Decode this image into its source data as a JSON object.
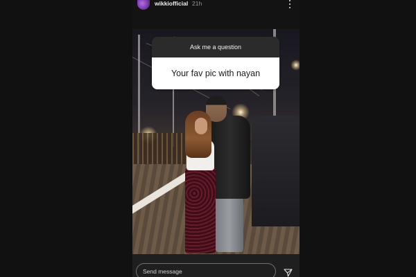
{
  "story": {
    "username": "wikkiofficial",
    "time_ago": "21h",
    "question_sticker": {
      "prompt": "Ask me a question",
      "answer": "Your fav pic with nayan"
    },
    "reply": {
      "placeholder": "Send message"
    }
  },
  "icons": {
    "more": "more-vertical-icon",
    "send": "paper-plane-icon"
  },
  "colors": {
    "background": "#111111",
    "sticker_header": "#2b2b2b",
    "sticker_body": "#ffffff"
  }
}
